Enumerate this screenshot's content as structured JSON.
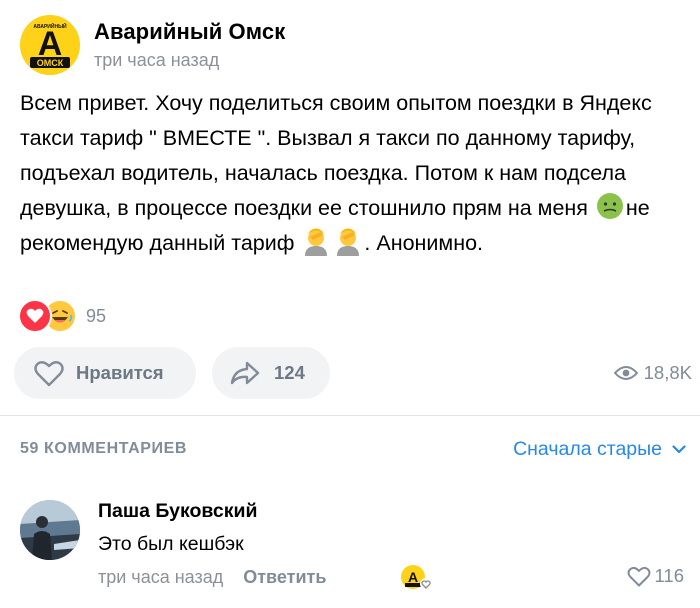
{
  "post": {
    "group_name": "Аварийный Омск",
    "time": "три часа назад",
    "avatar_text_top": "АВАРИЙНЫЙ",
    "avatar_text_bottom": "ОМСК",
    "avatar_letter": "А",
    "text_part1": "Всем привет. Хочу поделиться своим опытом поездки в Яндекс такси тариф \" ВМЕСТЕ \". Вызвал я такси по данному тарифу, подъехал водитель, началась поездка. Потом к нам подсела девушка, в процессе поездки ее стошнило прям на меня ",
    "text_part2": "не рекомендую данный тариф",
    "text_part3": ". Анонимно.",
    "emoji_1": "nauseated-face",
    "emoji_2": "person-facepalming",
    "emoji_3": "person-facepalming"
  },
  "reactions": {
    "icons": [
      "heart",
      "laughing-face"
    ],
    "count": "95"
  },
  "actions": {
    "like_label": "Нравится",
    "share_count": "124",
    "views": "18,8K"
  },
  "comments": {
    "count_label": "59 КОММЕНТАРИЕВ",
    "sort_label": "Сначала старые",
    "items": [
      {
        "author": "Паша Буковский",
        "text": "Это был кешбэк",
        "time": "три часа назад",
        "reply_label": "Ответить",
        "likes": "116"
      }
    ]
  },
  "colors": {
    "accent": "#2688eb",
    "secondary_text": "#818c99",
    "button_bg": "#f2f3f5",
    "brand_yellow": "#ffd21a",
    "heart_red": "#ff3347"
  }
}
